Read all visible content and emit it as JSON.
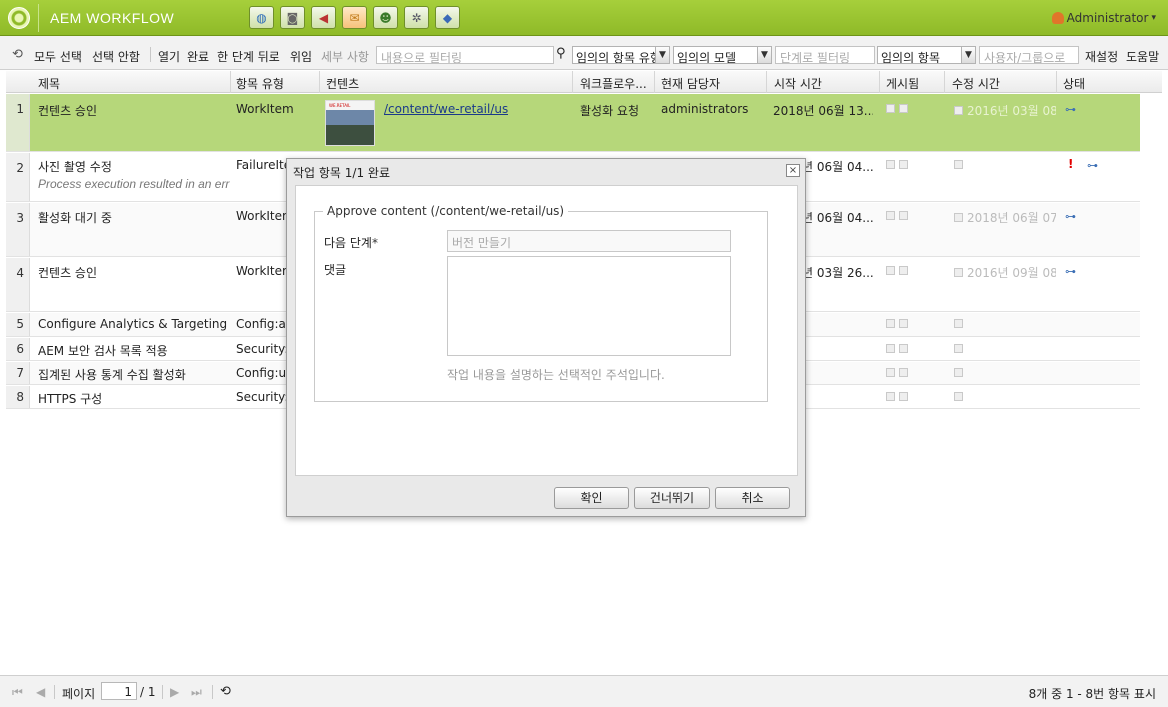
{
  "header": {
    "app_title": "AEM WORKFLOW",
    "user": "Administrator",
    "user_caret": "▾",
    "app_icons": [
      "globe-icon",
      "camera-icon",
      "megaphone-icon",
      "inbox-icon",
      "users-icon",
      "gear-icon",
      "tag-icon"
    ],
    "active_icon_index": 3,
    "accent_color": "#8fba28"
  },
  "toolbar": {
    "select_all": "모두 선택",
    "select_none": "선택 안함",
    "open": "열기",
    "complete": "완료",
    "step_back": "한 단계 뒤로",
    "delegate": "위임",
    "details": "세부 사항",
    "content_filter_placeholder": "내용으로 필터링",
    "item_type_select": "임의의 항목 유형",
    "model_select": "임의의 모델",
    "step_filter_placeholder": "단계로 필터링",
    "item_select": "임의의 항목",
    "user_group_placeholder": "사용자/그룹으로",
    "reset": "재설정",
    "help": "도움말"
  },
  "columns": [
    "제목",
    "항목 유형",
    "컨텐츠",
    "워크플로우...",
    "현재 담당자",
    "시작 시간",
    "게시됨",
    "수정 시간",
    "상태"
  ],
  "rows": [
    {
      "num": "1",
      "title": "컨텐츠 승인",
      "type": "WorkItem",
      "content": "/content/we-retail/us",
      "thumb_label": "WE.RETAIL",
      "workflow": "활성화 요청",
      "assignee": "administrators",
      "start": "2018년 06월 13...",
      "modified": "2016년 03월 08",
      "status_warn": ""
    },
    {
      "num": "2",
      "title": "사진 촬영 수정",
      "subtitle": "Process execution resulted in an err",
      "type": "FailureIte",
      "start": "년 06월 04...",
      "status_warn": "!"
    },
    {
      "num": "3",
      "title": "활성화 대기 중",
      "type": "WorkItem",
      "start": "년 06월 04...",
      "modified": "2018년 06월 07",
      "status_warn": ""
    },
    {
      "num": "4",
      "title": "컨텐츠 승인",
      "type": "WorkItem",
      "start": "년 03월 26...",
      "modified": "2016년 09월 08",
      "status_warn": ""
    },
    {
      "num": "5",
      "title": "Configure Analytics & Targeting",
      "type": "Config:an"
    },
    {
      "num": "6",
      "title": "AEM 보안 검사 목록 적용",
      "type": "Security:a"
    },
    {
      "num": "7",
      "title": "집계된 사용 통계 수집 활성화",
      "type": "Config:us"
    },
    {
      "num": "8",
      "title": "HTTPS 구성",
      "type": "Security:c"
    }
  ],
  "pager": {
    "page_label": "페이지",
    "page_value": "1",
    "of_pages": "/ 1",
    "summary": "8개 중 1 - 8번 항목 표시"
  },
  "dialog": {
    "title": "작업 항목 1/1 완료",
    "close": "×",
    "legend": "Approve content (/content/we-retail/us)",
    "next_step_label": "다음 단계",
    "required_mark": "*",
    "next_step_placeholder": "버전 만들기",
    "comment_label": "댓글",
    "comment_help": "작업 내용을 설명하는 선택적인 주석입니다.",
    "ok": "확인",
    "skip": "건너뛰기",
    "cancel": "취소"
  }
}
